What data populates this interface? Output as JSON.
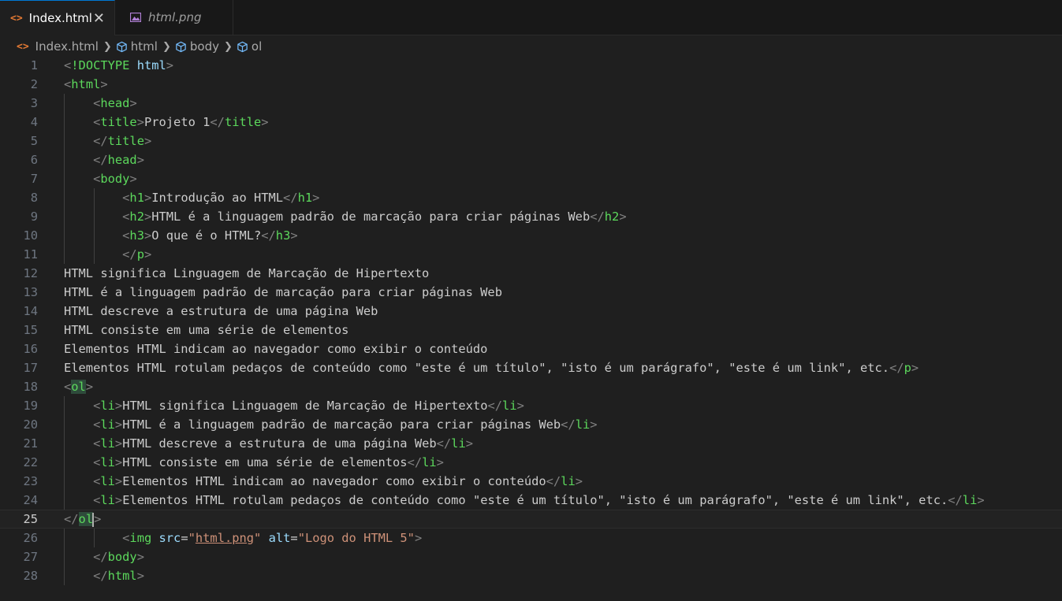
{
  "tabs": [
    {
      "label": "Index.html",
      "icon": "html-code-icon",
      "active": true
    },
    {
      "label": "html.png",
      "icon": "image-icon",
      "active": false
    }
  ],
  "breadcrumb": [
    {
      "label": "Index.html",
      "icon": "html-code-icon"
    },
    {
      "label": "html",
      "icon": "symbol-cube-icon"
    },
    {
      "label": "body",
      "icon": "symbol-cube-icon"
    },
    {
      "label": "ol",
      "icon": "symbol-cube-icon"
    }
  ],
  "editor": {
    "current_line": 25,
    "lines": [
      {
        "n": "1",
        "parts": [
          [
            "t",
            "<"
          ],
          [
            "g",
            "!DOCTYPE"
          ],
          [
            "x",
            " "
          ],
          [
            "a",
            "html"
          ],
          [
            "t",
            ">"
          ]
        ]
      },
      {
        "n": "2",
        "parts": [
          [
            "t",
            "<"
          ],
          [
            "g",
            "html"
          ],
          [
            "t",
            ">"
          ]
        ]
      },
      {
        "n": "3",
        "parts": [
          [
            "x",
            "    "
          ],
          [
            "t",
            "<"
          ],
          [
            "g",
            "head"
          ],
          [
            "t",
            ">"
          ]
        ]
      },
      {
        "n": "4",
        "parts": [
          [
            "x",
            "    "
          ],
          [
            "t",
            "<"
          ],
          [
            "g",
            "title"
          ],
          [
            "t",
            ">"
          ],
          [
            "x",
            "Projeto 1"
          ],
          [
            "t",
            "</"
          ],
          [
            "g",
            "title"
          ],
          [
            "t",
            ">"
          ]
        ]
      },
      {
        "n": "5",
        "parts": [
          [
            "x",
            "    "
          ],
          [
            "t",
            "</"
          ],
          [
            "g",
            "title"
          ],
          [
            "t",
            ">"
          ]
        ]
      },
      {
        "n": "6",
        "parts": [
          [
            "x",
            "    "
          ],
          [
            "t",
            "</"
          ],
          [
            "g",
            "head"
          ],
          [
            "t",
            ">"
          ]
        ]
      },
      {
        "n": "7",
        "parts": [
          [
            "x",
            "    "
          ],
          [
            "t",
            "<"
          ],
          [
            "g",
            "body"
          ],
          [
            "t",
            ">"
          ]
        ]
      },
      {
        "n": "8",
        "parts": [
          [
            "x",
            "        "
          ],
          [
            "t",
            "<"
          ],
          [
            "g",
            "h1"
          ],
          [
            "t",
            ">"
          ],
          [
            "x",
            "Introdução ao HTML"
          ],
          [
            "t",
            "</"
          ],
          [
            "g",
            "h1"
          ],
          [
            "t",
            ">"
          ]
        ]
      },
      {
        "n": "9",
        "parts": [
          [
            "x",
            "        "
          ],
          [
            "t",
            "<"
          ],
          [
            "g",
            "h2"
          ],
          [
            "t",
            ">"
          ],
          [
            "x",
            "HTML é a linguagem padrão de marcação para criar páginas Web"
          ],
          [
            "t",
            "</"
          ],
          [
            "g",
            "h2"
          ],
          [
            "t",
            ">"
          ]
        ]
      },
      {
        "n": "10",
        "parts": [
          [
            "x",
            "        "
          ],
          [
            "t",
            "<"
          ],
          [
            "g",
            "h3"
          ],
          [
            "t",
            ">"
          ],
          [
            "x",
            "O que é o HTML?"
          ],
          [
            "t",
            "</"
          ],
          [
            "g",
            "h3"
          ],
          [
            "t",
            ">"
          ]
        ]
      },
      {
        "n": "11",
        "parts": [
          [
            "x",
            "        "
          ],
          [
            "t",
            "</"
          ],
          [
            "g",
            "p"
          ],
          [
            "t",
            ">"
          ]
        ]
      },
      {
        "n": "12",
        "parts": [
          [
            "x",
            "HTML significa Linguagem de Marcação de Hipertexto"
          ]
        ]
      },
      {
        "n": "13",
        "parts": [
          [
            "x",
            "HTML é a linguagem padrão de marcação para criar páginas Web"
          ]
        ]
      },
      {
        "n": "14",
        "parts": [
          [
            "x",
            "HTML descreve a estrutura de uma página Web"
          ]
        ]
      },
      {
        "n": "15",
        "parts": [
          [
            "x",
            "HTML consiste em uma série de elementos"
          ]
        ]
      },
      {
        "n": "16",
        "parts": [
          [
            "x",
            "Elementos HTML indicam ao navegador como exibir o conteúdo"
          ]
        ]
      },
      {
        "n": "17",
        "parts": [
          [
            "x",
            "Elementos HTML rotulam pedaços de conteúdo como \"este é um título\", \"isto é um parágrafo\", \"este é um link\", etc."
          ],
          [
            "t",
            "</"
          ],
          [
            "g",
            "p"
          ],
          [
            "t",
            ">"
          ]
        ]
      },
      {
        "n": "18",
        "parts": [
          [
            "t",
            "<"
          ],
          [
            "gh",
            "ol"
          ],
          [
            "t",
            ">"
          ]
        ]
      },
      {
        "n": "19",
        "parts": [
          [
            "x",
            "    "
          ],
          [
            "t",
            "<"
          ],
          [
            "g",
            "li"
          ],
          [
            "t",
            ">"
          ],
          [
            "x",
            "HTML significa Linguagem de Marcação de Hipertexto"
          ],
          [
            "t",
            "</"
          ],
          [
            "g",
            "li"
          ],
          [
            "t",
            ">"
          ]
        ]
      },
      {
        "n": "20",
        "parts": [
          [
            "x",
            "    "
          ],
          [
            "t",
            "<"
          ],
          [
            "g",
            "li"
          ],
          [
            "t",
            ">"
          ],
          [
            "x",
            "HTML é a linguagem padrão de marcação para criar páginas Web"
          ],
          [
            "t",
            "</"
          ],
          [
            "g",
            "li"
          ],
          [
            "t",
            ">"
          ]
        ]
      },
      {
        "n": "21",
        "parts": [
          [
            "x",
            "    "
          ],
          [
            "t",
            "<"
          ],
          [
            "g",
            "li"
          ],
          [
            "t",
            ">"
          ],
          [
            "x",
            "HTML descreve a estrutura de uma página Web"
          ],
          [
            "t",
            "</"
          ],
          [
            "g",
            "li"
          ],
          [
            "t",
            ">"
          ]
        ]
      },
      {
        "n": "22",
        "parts": [
          [
            "x",
            "    "
          ],
          [
            "t",
            "<"
          ],
          [
            "g",
            "li"
          ],
          [
            "t",
            ">"
          ],
          [
            "x",
            "HTML consiste em uma série de elementos"
          ],
          [
            "t",
            "</"
          ],
          [
            "g",
            "li"
          ],
          [
            "t",
            ">"
          ]
        ]
      },
      {
        "n": "23",
        "parts": [
          [
            "x",
            "    "
          ],
          [
            "t",
            "<"
          ],
          [
            "g",
            "li"
          ],
          [
            "t",
            ">"
          ],
          [
            "x",
            "Elementos HTML indicam ao navegador como exibir o conteúdo"
          ],
          [
            "t",
            "</"
          ],
          [
            "g",
            "li"
          ],
          [
            "t",
            ">"
          ]
        ]
      },
      {
        "n": "24",
        "parts": [
          [
            "x",
            "    "
          ],
          [
            "t",
            "<"
          ],
          [
            "g",
            "li"
          ],
          [
            "t",
            ">"
          ],
          [
            "x",
            "Elementos HTML rotulam pedaços de conteúdo como \"este é um título\", \"isto é um parágrafo\", \"este é um link\", etc."
          ],
          [
            "t",
            "</"
          ],
          [
            "g",
            "li"
          ],
          [
            "t",
            ">"
          ]
        ]
      },
      {
        "n": "25",
        "parts": [
          [
            "t",
            "</"
          ],
          [
            "gh",
            "ol"
          ],
          [
            "c",
            ""
          ],
          [
            "t",
            ">"
          ]
        ]
      },
      {
        "n": "26",
        "parts": [
          [
            "x",
            "        "
          ],
          [
            "t",
            "<"
          ],
          [
            "g",
            "img"
          ],
          [
            "x",
            " "
          ],
          [
            "a",
            "src"
          ],
          [
            "x",
            "="
          ],
          [
            "s",
            "\""
          ],
          [
            "su",
            "html.png"
          ],
          [
            "s",
            "\""
          ],
          [
            "x",
            " "
          ],
          [
            "a",
            "alt"
          ],
          [
            "x",
            "="
          ],
          [
            "s",
            "\"Logo do HTML 5\""
          ],
          [
            "t",
            ">"
          ]
        ]
      },
      {
        "n": "27",
        "parts": [
          [
            "x",
            "    "
          ],
          [
            "t",
            "</"
          ],
          [
            "g",
            "body"
          ],
          [
            "t",
            ">"
          ]
        ]
      },
      {
        "n": "28",
        "parts": [
          [
            "x",
            "    "
          ],
          [
            "t",
            "</"
          ],
          [
            "g",
            "html"
          ],
          [
            "t",
            ">"
          ]
        ]
      }
    ]
  }
}
